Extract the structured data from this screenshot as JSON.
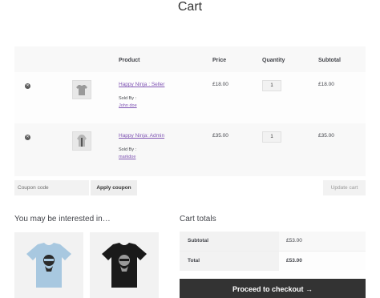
{
  "page": {
    "title": "Cart"
  },
  "cart": {
    "headers": {
      "product": "Product",
      "price": "Price",
      "quantity": "Quantity",
      "subtotal": "Subtotal"
    },
    "items": [
      {
        "name": "Happy Ninja : Seller",
        "sold_by_label": "Sold By :",
        "seller": "John doe",
        "price": "£18.00",
        "quantity": "1",
        "subtotal": "£18.00",
        "thumb_icon": "tshirt-icon"
      },
      {
        "name": "Happy Ninja: Admin",
        "sold_by_label": "Sold By :",
        "seller": "markdoe",
        "price": "£35.00",
        "quantity": "1",
        "subtotal": "£35.00",
        "thumb_icon": "hoodie-icon"
      }
    ],
    "coupon_placeholder": "Coupon code",
    "apply_coupon_label": "Apply coupon",
    "update_cart_label": "Update cart"
  },
  "cross_sells": {
    "title": "You may be interested in…",
    "products": [
      {
        "icon": "light-blue-tshirt-icon",
        "color": "#a8c8e0"
      },
      {
        "icon": "black-tshirt-icon",
        "color": "#1a1a1a"
      }
    ]
  },
  "totals": {
    "title": "Cart totals",
    "subtotal_label": "Subtotal",
    "subtotal_value": "£53.00",
    "total_label": "Total",
    "total_value": "£53.00",
    "checkout_label": "Proceed to checkout",
    "checkout_arrow": "→"
  },
  "colors": {
    "link": "#7f54b3",
    "checkout_bg": "#333333"
  }
}
